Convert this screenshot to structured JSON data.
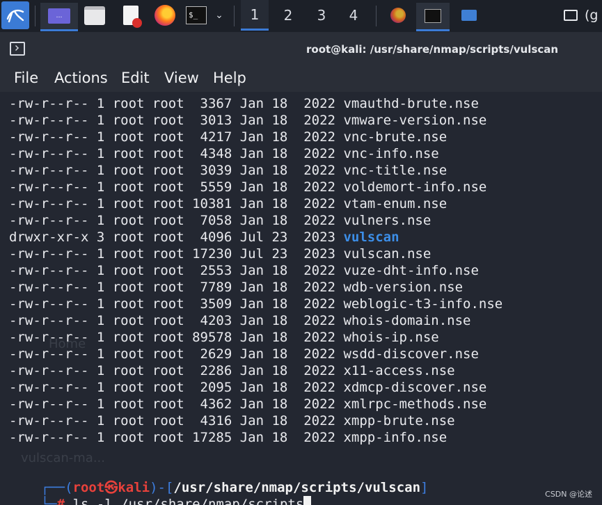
{
  "taskbar": {
    "workspaces": [
      "1",
      "2",
      "3",
      "4"
    ],
    "right_text": "(g"
  },
  "window": {
    "title": "root@kali: /usr/share/nmap/scripts/vulscan"
  },
  "menu": [
    "File",
    "Actions",
    "Edit",
    "View",
    "Help"
  ],
  "listing": [
    {
      "perms": "-rw-r--r--",
      "links": "1",
      "owner": "root",
      "group": "root",
      "size": "3367",
      "month": "Jan",
      "day": "18",
      "year": "2022",
      "name": "vmauthd-brute.nse",
      "is_dir": false
    },
    {
      "perms": "-rw-r--r--",
      "links": "1",
      "owner": "root",
      "group": "root",
      "size": "3013",
      "month": "Jan",
      "day": "18",
      "year": "2022",
      "name": "vmware-version.nse",
      "is_dir": false
    },
    {
      "perms": "-rw-r--r--",
      "links": "1",
      "owner": "root",
      "group": "root",
      "size": "4217",
      "month": "Jan",
      "day": "18",
      "year": "2022",
      "name": "vnc-brute.nse",
      "is_dir": false
    },
    {
      "perms": "-rw-r--r--",
      "links": "1",
      "owner": "root",
      "group": "root",
      "size": "4348",
      "month": "Jan",
      "day": "18",
      "year": "2022",
      "name": "vnc-info.nse",
      "is_dir": false
    },
    {
      "perms": "-rw-r--r--",
      "links": "1",
      "owner": "root",
      "group": "root",
      "size": "3039",
      "month": "Jan",
      "day": "18",
      "year": "2022",
      "name": "vnc-title.nse",
      "is_dir": false
    },
    {
      "perms": "-rw-r--r--",
      "links": "1",
      "owner": "root",
      "group": "root",
      "size": "5559",
      "month": "Jan",
      "day": "18",
      "year": "2022",
      "name": "voldemort-info.nse",
      "is_dir": false
    },
    {
      "perms": "-rw-r--r--",
      "links": "1",
      "owner": "root",
      "group": "root",
      "size": "10381",
      "month": "Jan",
      "day": "18",
      "year": "2022",
      "name": "vtam-enum.nse",
      "is_dir": false
    },
    {
      "perms": "-rw-r--r--",
      "links": "1",
      "owner": "root",
      "group": "root",
      "size": "7058",
      "month": "Jan",
      "day": "18",
      "year": "2022",
      "name": "vulners.nse",
      "is_dir": false
    },
    {
      "perms": "drwxr-xr-x",
      "links": "3",
      "owner": "root",
      "group": "root",
      "size": "4096",
      "month": "Jul",
      "day": "23",
      "year": "2023",
      "name": "vulscan",
      "is_dir": true
    },
    {
      "perms": "-rw-r--r--",
      "links": "1",
      "owner": "root",
      "group": "root",
      "size": "17230",
      "month": "Jul",
      "day": "23",
      "year": "2023",
      "name": "vulscan.nse",
      "is_dir": false
    },
    {
      "perms": "-rw-r--r--",
      "links": "1",
      "owner": "root",
      "group": "root",
      "size": "2553",
      "month": "Jan",
      "day": "18",
      "year": "2022",
      "name": "vuze-dht-info.nse",
      "is_dir": false
    },
    {
      "perms": "-rw-r--r--",
      "links": "1",
      "owner": "root",
      "group": "root",
      "size": "7789",
      "month": "Jan",
      "day": "18",
      "year": "2022",
      "name": "wdb-version.nse",
      "is_dir": false
    },
    {
      "perms": "-rw-r--r--",
      "links": "1",
      "owner": "root",
      "group": "root",
      "size": "3509",
      "month": "Jan",
      "day": "18",
      "year": "2022",
      "name": "weblogic-t3-info.nse",
      "is_dir": false
    },
    {
      "perms": "-rw-r--r--",
      "links": "1",
      "owner": "root",
      "group": "root",
      "size": "4203",
      "month": "Jan",
      "day": "18",
      "year": "2022",
      "name": "whois-domain.nse",
      "is_dir": false
    },
    {
      "perms": "-rw-r--r--",
      "links": "1",
      "owner": "root",
      "group": "root",
      "size": "89578",
      "month": "Jan",
      "day": "18",
      "year": "2022",
      "name": "whois-ip.nse",
      "is_dir": false
    },
    {
      "perms": "-rw-r--r--",
      "links": "1",
      "owner": "root",
      "group": "root",
      "size": "2629",
      "month": "Jan",
      "day": "18",
      "year": "2022",
      "name": "wsdd-discover.nse",
      "is_dir": false
    },
    {
      "perms": "-rw-r--r--",
      "links": "1",
      "owner": "root",
      "group": "root",
      "size": "2286",
      "month": "Jan",
      "day": "18",
      "year": "2022",
      "name": "x11-access.nse",
      "is_dir": false
    },
    {
      "perms": "-rw-r--r--",
      "links": "1",
      "owner": "root",
      "group": "root",
      "size": "2095",
      "month": "Jan",
      "day": "18",
      "year": "2022",
      "name": "xdmcp-discover.nse",
      "is_dir": false
    },
    {
      "perms": "-rw-r--r--",
      "links": "1",
      "owner": "root",
      "group": "root",
      "size": "4362",
      "month": "Jan",
      "day": "18",
      "year": "2022",
      "name": "xmlrpc-methods.nse",
      "is_dir": false
    },
    {
      "perms": "-rw-r--r--",
      "links": "1",
      "owner": "root",
      "group": "root",
      "size": "4316",
      "month": "Jan",
      "day": "18",
      "year": "2022",
      "name": "xmpp-brute.nse",
      "is_dir": false
    },
    {
      "perms": "-rw-r--r--",
      "links": "1",
      "owner": "root",
      "group": "root",
      "size": "17285",
      "month": "Jan",
      "day": "18",
      "year": "2022",
      "name": "xmpp-info.nse",
      "is_dir": false
    }
  ],
  "prompt": {
    "user": "root",
    "at_symbol": "㉿",
    "host": "kali",
    "cwd": "/usr/share/nmap/scripts/vulscan",
    "marker": "#",
    "command": "ls -l",
    "argument": "/usr/share/nmap/scripts"
  },
  "desktop_watermarks": [
    "vulscan-ma...",
    "Home"
  ],
  "credit": "CSDN @论述",
  "colors": {
    "directory": "#3c8ee8",
    "prompt_user": "#e8413b",
    "prompt_frame": "#3d7ee0",
    "accent": "#3b7bd6"
  }
}
